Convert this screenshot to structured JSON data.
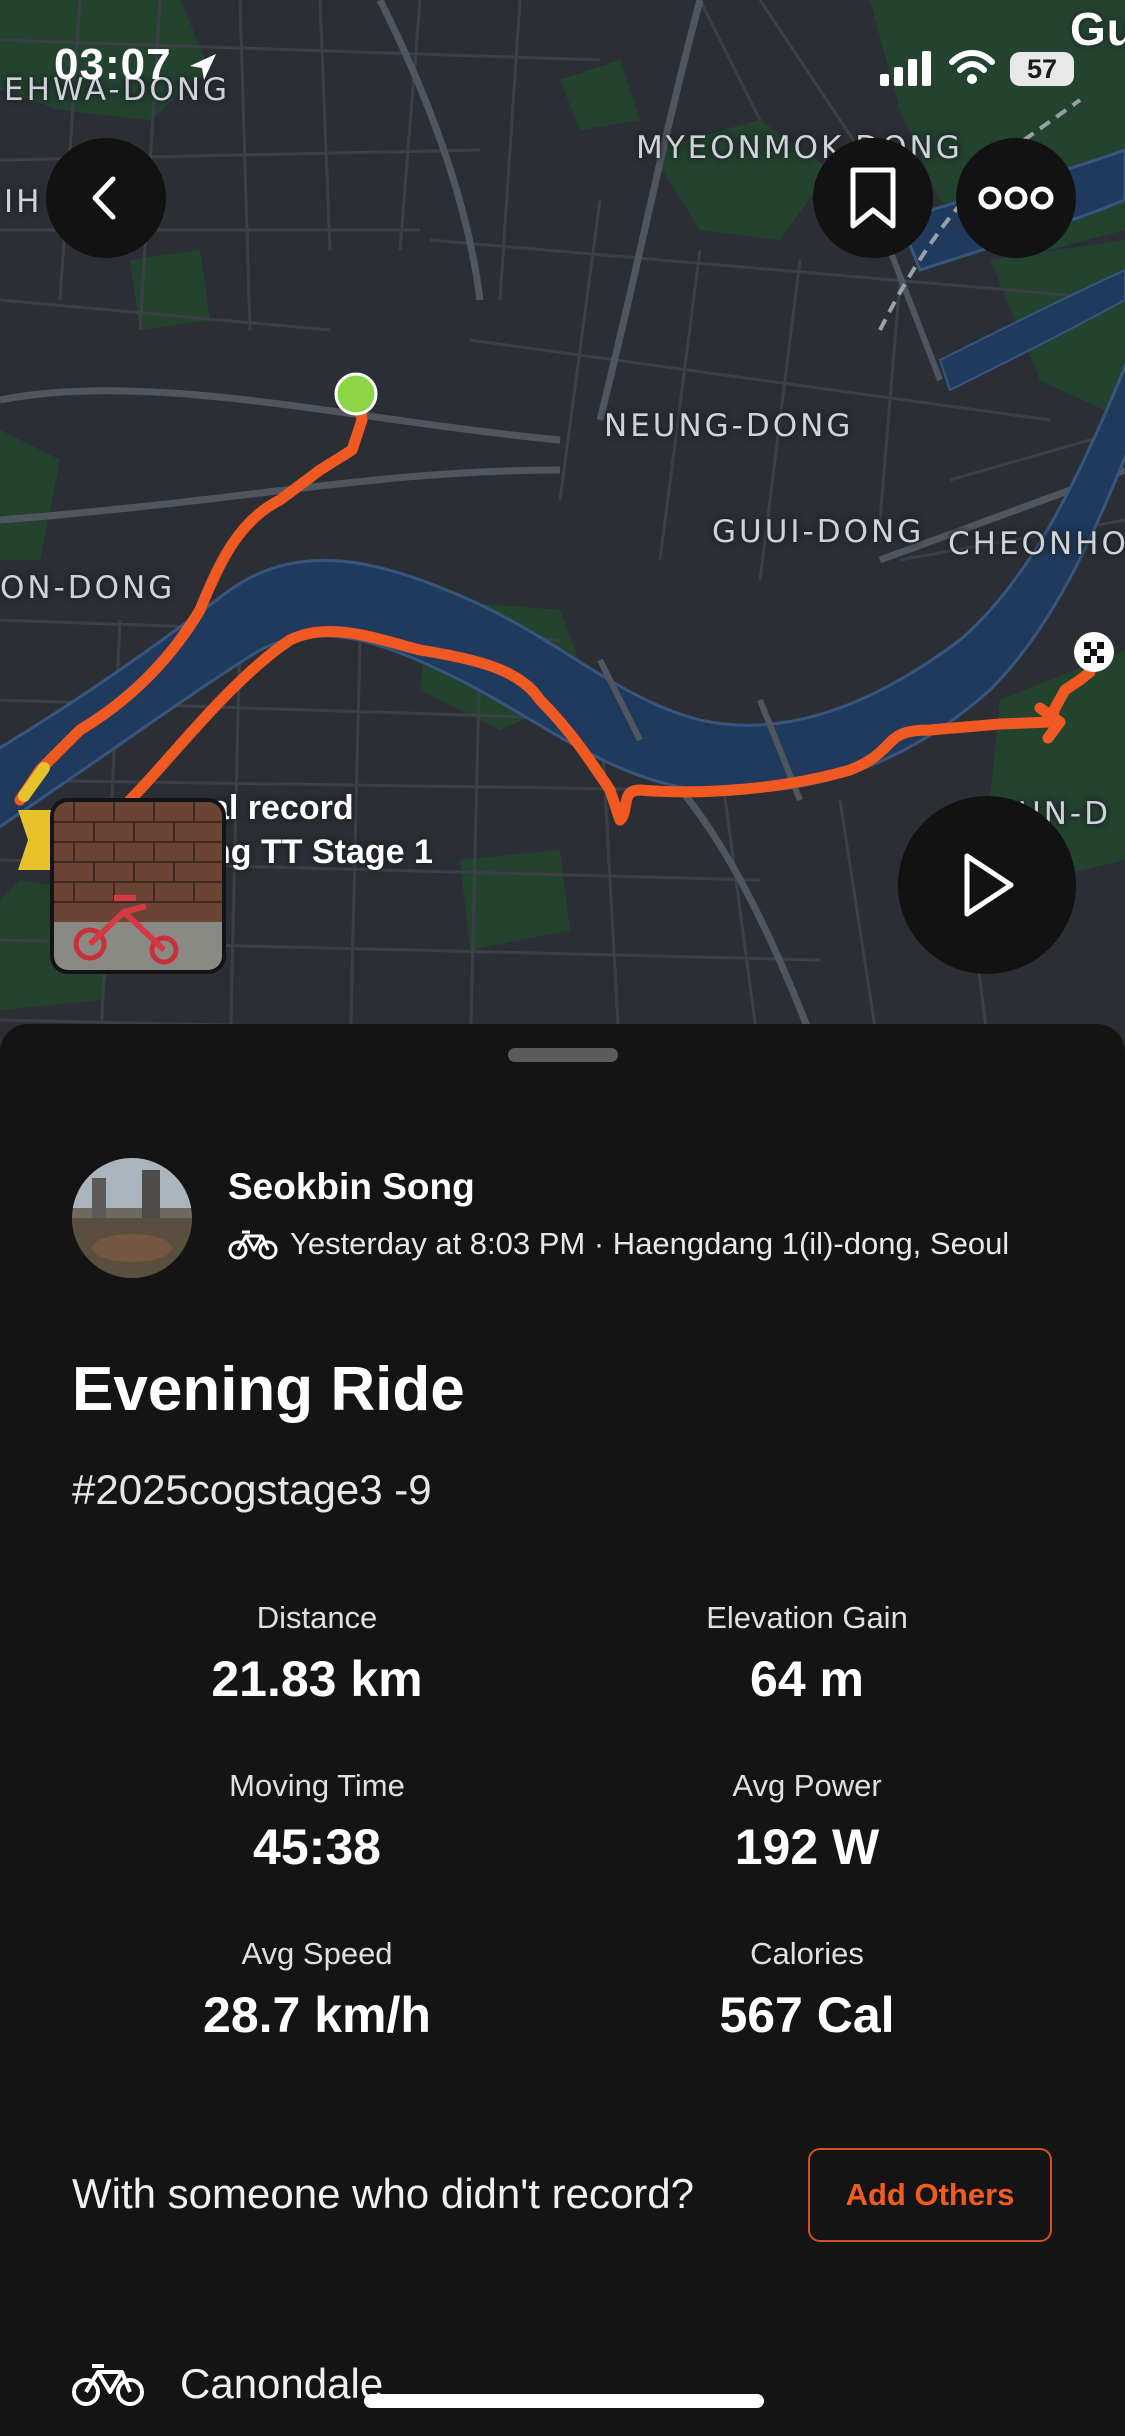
{
  "status_bar": {
    "time": "03:07",
    "battery": "57",
    "corner_text": "Gu"
  },
  "map": {
    "labels": [
      {
        "id": "ehwa",
        "text": "EHWA-DONG"
      },
      {
        "id": "ihwa",
        "text": "IH    NG"
      },
      {
        "id": "myeonmok",
        "text": "MYEONMOK-DONG"
      },
      {
        "id": "neung",
        "text": "NEUNG-DONG"
      },
      {
        "id": "guui",
        "text": "GUUI-DONG"
      },
      {
        "id": "cheonho",
        "text": "CHEONHO"
      },
      {
        "id": "on",
        "text": "ON-DONG"
      },
      {
        "id": "un",
        "text": "UN-D"
      }
    ],
    "segment_label_line1": "al record",
    "segment_label_line2": "ng TT Stage 1",
    "route_color": "#f05a22",
    "start_marker_color": "#8cd646"
  },
  "buttons": {
    "back": "back",
    "bookmark": "bookmark",
    "more": "more",
    "play": "play"
  },
  "activity": {
    "athlete_name": "Seokbin Song",
    "meta": "Yesterday at 8:03 PM · Haengdang 1(il)-dong, Seoul",
    "title": "Evening Ride",
    "description": "#2025cogstage3 -9",
    "stats": [
      {
        "label": "Distance",
        "value": "21.83 km"
      },
      {
        "label": "Elevation Gain",
        "value": "64 m"
      },
      {
        "label": "Moving Time",
        "value": "45:38"
      },
      {
        "label": "Avg Power",
        "value": "192 W"
      },
      {
        "label": "Avg Speed",
        "value": "28.7 km/h"
      },
      {
        "label": "Calories",
        "value": "567 Cal"
      }
    ],
    "with_prompt": "With someone who didn't record?",
    "add_others_label": "Add Others",
    "gear_name": "Canondale"
  },
  "colors": {
    "accent": "#f25c1f",
    "background": "#141414"
  }
}
